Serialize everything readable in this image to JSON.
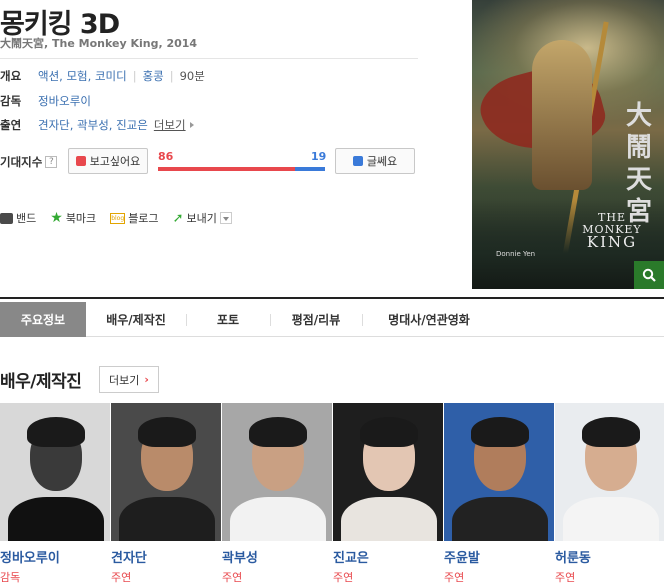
{
  "movie": {
    "title": "몽키킹 3D",
    "subtitle": "大鬧天宮, The Monkey King, 2014",
    "overview_label": "개요",
    "genres": "액션, 모험, 코미디",
    "country": "홍콩",
    "runtime": "90분",
    "director_label": "감독",
    "director": "정바오루이",
    "cast_label": "출연",
    "cast_names": "견자단, 곽부성, 진교은",
    "cast_more": "더보기"
  },
  "expectation": {
    "label": "기대지수",
    "help": "?",
    "like_label": "보고싶어요",
    "dislike_label": "글쎄요",
    "like_count": "86",
    "dislike_count": "19",
    "like_ratio": 0.819
  },
  "share": {
    "band": "밴드",
    "bookmark": "북마크",
    "blog": "블로그",
    "blog_icon_text": "blog",
    "send": "보내기"
  },
  "poster": {
    "calligraphy": "大鬧天宮",
    "en_the": "THE",
    "en_monkey": "MONKEY",
    "en_king": "KING",
    "actor": "Donnie Yen"
  },
  "tabs": [
    {
      "label": "주요정보"
    },
    {
      "label": "배우/제작진"
    },
    {
      "label": "포토"
    },
    {
      "label": "평점/리뷰"
    },
    {
      "label": "명대사/연관영화"
    }
  ],
  "section": {
    "title": "배우/제작진",
    "more": "더보기"
  },
  "people": [
    {
      "name": "정바오루이",
      "role": "감독",
      "bg": "#d8d8d8",
      "skin": "#3a3a3a",
      "cloth": "#111111"
    },
    {
      "name": "견자단",
      "role": "주연",
      "bg": "#4a4a4a",
      "skin": "#b98b6a",
      "cloth": "#1e1e1e"
    },
    {
      "name": "곽부성",
      "role": "주연",
      "bg": "#a7a7a7",
      "skin": "#c9a083",
      "cloth": "#f2f2f2"
    },
    {
      "name": "진교은",
      "role": "주연",
      "bg": "#1e1e1e",
      "skin": "#e3c6b3",
      "cloth": "#e8e4df"
    },
    {
      "name": "주윤발",
      "role": "주연",
      "bg": "#2f5fa8",
      "skin": "#b07d5c",
      "cloth": "#222222"
    },
    {
      "name": "허룬동",
      "role": "주연",
      "bg": "#e9ecef",
      "skin": "#d6ad90",
      "cloth": "#f4f4f4"
    }
  ]
}
